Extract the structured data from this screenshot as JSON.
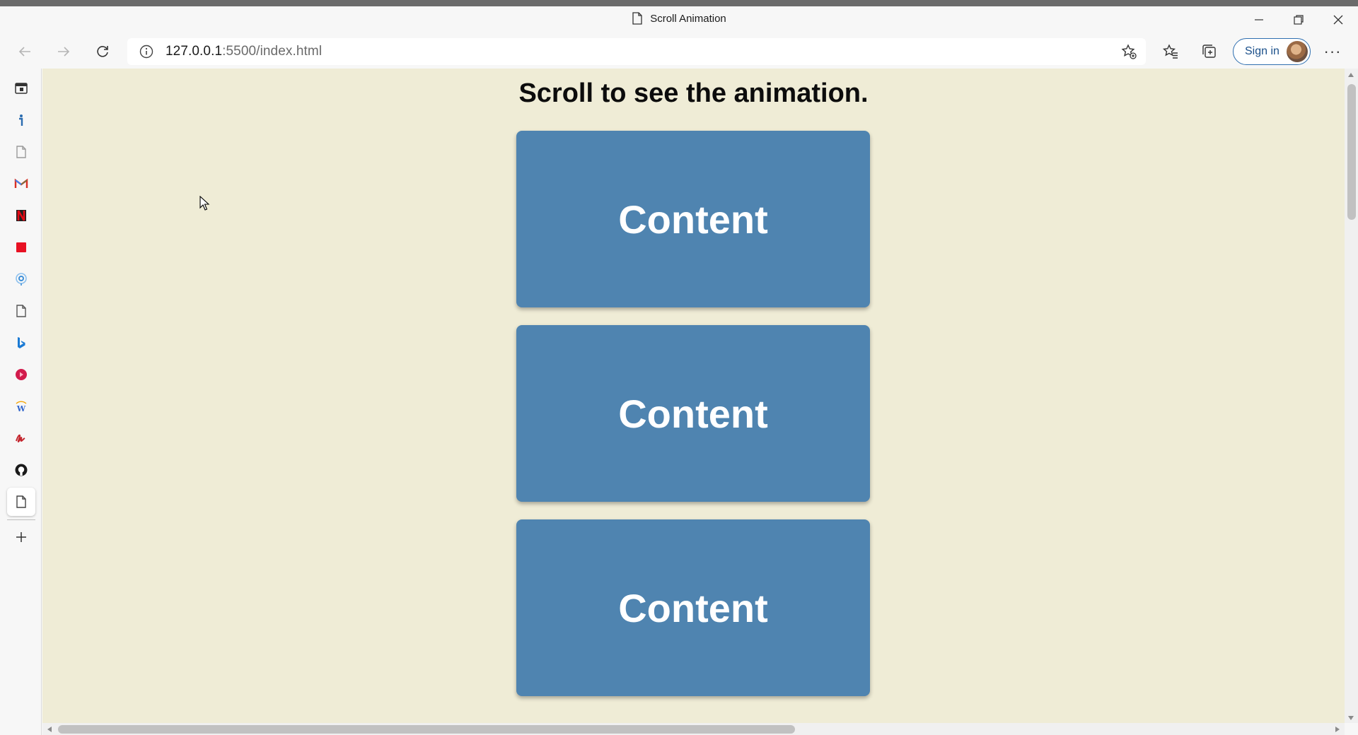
{
  "window": {
    "title": "Scroll Animation"
  },
  "address_bar": {
    "url_host": "127.0.0.1",
    "url_rest": ":5500/index.html"
  },
  "toolbar": {
    "sign_in_label": "Sign in",
    "more_label": "···"
  },
  "sidebar": {
    "items": [
      {
        "icon": "office-icon",
        "color": "#333333"
      },
      {
        "icon": "info-icon",
        "color": "#2b6cb0"
      },
      {
        "icon": "page-icon",
        "color": "#9a9a9a"
      },
      {
        "icon": "gmail-icon",
        "color": "#d93025"
      },
      {
        "icon": "netflix-icon",
        "color": "#c40812"
      },
      {
        "icon": "red-square-icon",
        "color": "#e81123"
      },
      {
        "icon": "location-icon",
        "color": "#3e8fd8"
      },
      {
        "icon": "page-icon",
        "color": "#555555"
      },
      {
        "icon": "bing-icon",
        "color": "#1a7ad4"
      },
      {
        "icon": "video-icon",
        "color": "#d21b4c"
      },
      {
        "icon": "wikipedia-icon",
        "color": "#3366cc"
      },
      {
        "icon": "signature-icon",
        "color": "#c4262e"
      },
      {
        "icon": "github-icon",
        "color": "#1a1a1a"
      },
      {
        "icon": "page-icon",
        "color": "#555555"
      }
    ]
  },
  "page": {
    "heading": "Scroll to see the animation.",
    "background": "#efecd6",
    "box_color": "#4f84b0",
    "boxes": [
      {
        "label": "Content"
      },
      {
        "label": "Content"
      },
      {
        "label": "Content"
      }
    ]
  }
}
